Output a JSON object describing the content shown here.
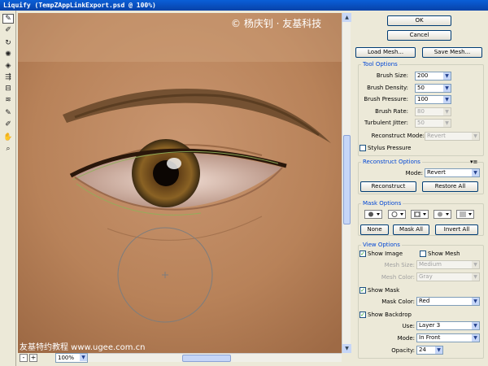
{
  "window": {
    "title": "Liquify (TempZAppLinkExport.psd @ 100%)"
  },
  "watermarks": {
    "top": "© 杨庆钊 · 友基科技",
    "bottom": "友基特约教程 www.ugee.com.cn"
  },
  "buttons": {
    "ok": "OK",
    "cancel": "Cancel",
    "load_mesh": "Load Mesh...",
    "save_mesh": "Save Mesh..."
  },
  "tool_options": {
    "title": "Tool Options",
    "brush_size": {
      "label": "Brush Size:",
      "value": "200"
    },
    "brush_density": {
      "label": "Brush Density:",
      "value": "50"
    },
    "brush_pressure": {
      "label": "Brush Pressure:",
      "value": "100"
    },
    "brush_rate": {
      "label": "Brush Rate:",
      "value": "80"
    },
    "turbulent_jitter": {
      "label": "Turbulent Jitter:",
      "value": "50"
    },
    "reconstruct_mode": {
      "label": "Reconstruct Mode:",
      "value": "Revert"
    },
    "stylus_pressure": {
      "label": "Stylus Pressure",
      "checked": false
    }
  },
  "reconstruct_options": {
    "title": "Reconstruct Options",
    "mode": {
      "label": "Mode:",
      "value": "Revert"
    },
    "reconstruct_label": "Reconstruct",
    "restore_all_label": "Restore All"
  },
  "mask_options": {
    "title": "Mask Options",
    "none_label": "None",
    "mask_all_label": "Mask All",
    "invert_all_label": "Invert All"
  },
  "view_options": {
    "title": "View Options",
    "show_image": {
      "label": "Show Image",
      "checked": true
    },
    "show_mesh": {
      "label": "Show Mesh",
      "checked": false
    },
    "mesh_size": {
      "label": "Mesh Size:",
      "value": "Medium"
    },
    "mesh_color": {
      "label": "Mesh Color:",
      "value": "Gray"
    },
    "show_mask": {
      "label": "Show Mask",
      "checked": true
    },
    "mask_color": {
      "label": "Mask Color:",
      "value": "Red"
    },
    "show_backdrop": {
      "label": "Show Backdrop",
      "checked": true
    },
    "use": {
      "label": "Use:",
      "value": "Layer 3"
    },
    "mode": {
      "label": "Mode:",
      "value": "In Front"
    },
    "opacity": {
      "label": "Opacity:",
      "value": "24"
    }
  },
  "zoom": {
    "value": "100%",
    "minus": "-",
    "plus": "+"
  },
  "icons": {
    "check_mark": "✓",
    "dropdown": "▼",
    "menu": "▾≡"
  }
}
